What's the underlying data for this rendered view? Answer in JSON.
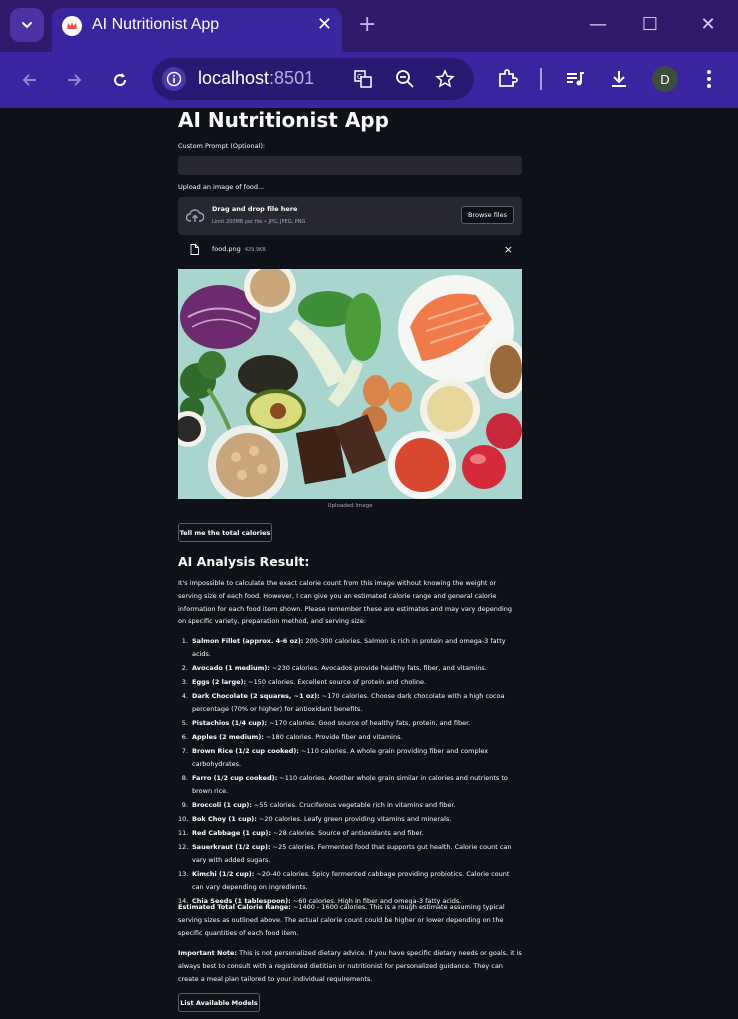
{
  "browser": {
    "tab_title": "AI Nutritionist App",
    "url_host": "localhost",
    "url_port": ":8501",
    "profile_initial": "D"
  },
  "colors": {
    "tab_strip": "#301a6b",
    "toolbar": "#3b24a0",
    "app_bg": "#0e1117",
    "input_bg": "#262730"
  },
  "icons": [
    "tab-search-icon",
    "favicon-icon",
    "close-icon",
    "new-tab-icon",
    "minimize-icon",
    "maximize-icon",
    "back-icon",
    "forward-icon",
    "reload-icon",
    "site-info-icon",
    "translate-icon",
    "zoom-out-icon",
    "bookmark-star-icon",
    "extensions-icon",
    "media-control-icon",
    "download-icon",
    "menu-icon",
    "upload-cloud-icon",
    "file-icon"
  ],
  "app": {
    "title": "AI Nutritionist App",
    "prompt_label": "Custom Prompt (Optional):",
    "prompt_value": "",
    "upload_label": "Upload an image of food...",
    "dropzone_title": "Drag and drop file here",
    "dropzone_limit": "Limit 200MB per file • JPG, JPEG, PNG",
    "browse_label": "Browse files",
    "file_name": "food.png",
    "file_size": "429.9KB",
    "image_caption": "Uploaded Image",
    "calories_button": "Tell me the total calories",
    "result_title": "AI Analysis Result:",
    "intro": "It's impossible to calculate the exact calorie count from this image without knowing the weight or serving size of each food. However, I can give you an estimated calorie range and general calorie information for each food item shown. Please remember these are estimates and may vary depending on specific variety, preparation method, and serving size:",
    "items": [
      {
        "num": "1.",
        "name": "Salmon Fillet (approx. 4-6 oz):",
        "desc": " 200-300 calories. Salmon is rich in protein and omega-3 fatty acids."
      },
      {
        "num": "2.",
        "name": "Avocado (1 medium):",
        "desc": " ~230 calories. Avocados provide healthy fats, fiber, and vitamins."
      },
      {
        "num": "3.",
        "name": "Eggs (2 large):",
        "desc": " ~150 calories. Excellent source of protein and choline."
      },
      {
        "num": "4.",
        "name": "Dark Chocolate (2 squares, ~1 oz):",
        "desc": " ~170 calories. Choose dark chocolate with a high cocoa percentage (70% or higher) for antioxidant benefits."
      },
      {
        "num": "5.",
        "name": "Pistachios (1/4 cup):",
        "desc": " ~170 calories. Good source of healthy fats, protein, and fiber."
      },
      {
        "num": "6.",
        "name": "Apples (2 medium):",
        "desc": " ~180 calories. Provide fiber and vitamins."
      },
      {
        "num": "7.",
        "name": "Brown Rice (1/2 cup cooked):",
        "desc": " ~110 calories. A whole grain providing fiber and complex carbohydrates."
      },
      {
        "num": "8.",
        "name": "Farro (1/2 cup cooked):",
        "desc": " ~110 calories. Another whole grain similar in calories and nutrients to brown rice."
      },
      {
        "num": "9.",
        "name": "Broccoli (1 cup):",
        "desc": " ~55 calories. Cruciferous vegetable rich in vitamins and fiber."
      },
      {
        "num": "10.",
        "name": "Bok Choy (1 cup):",
        "desc": " ~20 calories. Leafy green providing vitamins and minerals."
      },
      {
        "num": "11.",
        "name": "Red Cabbage (1 cup):",
        "desc": " ~28 calories. Source of antioxidants and fiber."
      },
      {
        "num": "12.",
        "name": "Sauerkraut (1/2 cup):",
        "desc": " ~25 calories. Fermented food that supports gut health. Calorie count can vary with added sugars."
      },
      {
        "num": "13.",
        "name": "Kimchi (1/2 cup):",
        "desc": " ~20-40 calories. Spicy fermented cabbage providing probiotics. Calorie count can vary depending on ingredients."
      },
      {
        "num": "14.",
        "name": "Chia Seeds (1 tablespoon):",
        "desc": " ~60 calories. High in fiber and omega-3 fatty acids."
      }
    ],
    "total_label": "Estimated Total Calorie Range:",
    "total_text": " ~1400 - 1600 calories. This is a rough estimate assuming typical serving sizes as outlined above. The actual calorie count could be higher or lower depending on the specific quantities of each food item.",
    "note_label": "Important Note:",
    "note_text": " This is not personalized dietary advice. If you have specific dietary needs or goals, it is always best to consult with a registered dietitian or nutritionist for personalized guidance. They can create a meal plan tailored to your individual requirements.",
    "models_button": "List Available Models"
  }
}
